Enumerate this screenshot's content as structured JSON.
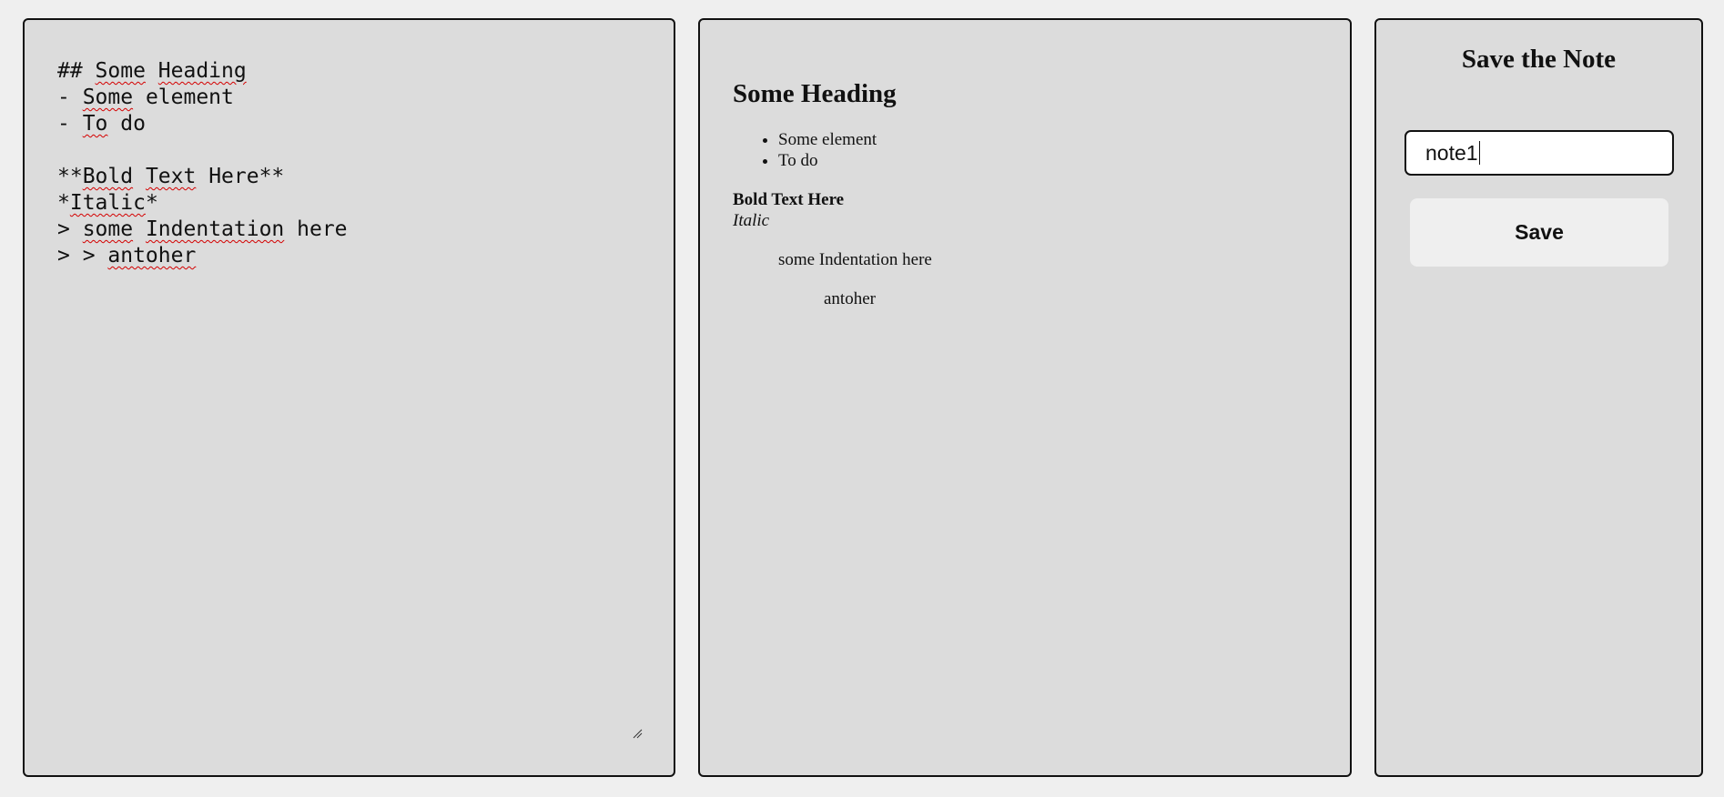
{
  "editor": {
    "lines": [
      [
        {
          "t": "## "
        },
        {
          "t": "Some",
          "sp": true
        },
        {
          "t": " "
        },
        {
          "t": "Heading",
          "sp": true
        }
      ],
      [
        {
          "t": "- "
        },
        {
          "t": "Some",
          "sp": true
        },
        {
          "t": " element"
        }
      ],
      [
        {
          "t": "- "
        },
        {
          "t": "To",
          "sp": true
        },
        {
          "t": " do"
        }
      ],
      [],
      [
        {
          "t": "**"
        },
        {
          "t": "Bold",
          "sp": true
        },
        {
          "t": " "
        },
        {
          "t": "Text",
          "sp": true
        },
        {
          "t": " Here**"
        }
      ],
      [
        {
          "t": "*"
        },
        {
          "t": "Italic",
          "sp": true
        },
        {
          "t": "*"
        }
      ],
      [
        {
          "t": "> "
        },
        {
          "t": "some",
          "sp": true
        },
        {
          "t": " "
        },
        {
          "t": "Indentation",
          "sp": true
        },
        {
          "t": " here"
        }
      ],
      [
        {
          "t": "> > "
        },
        {
          "t": "antoher",
          "sp": true
        }
      ]
    ]
  },
  "preview": {
    "heading": "Some Heading",
    "list_items": [
      "Some element",
      "To do"
    ],
    "bold_text": "Bold Text Here",
    "italic_text": "Italic",
    "quote_level1": "some Indentation here",
    "quote_level2": "antoher"
  },
  "save_panel": {
    "title": "Save the Note",
    "input_value": "note1",
    "button_label": "Save"
  },
  "colors": {
    "page_background": "#efefef",
    "panel_background": "#dcdcdc",
    "border": "#111111",
    "spellcheck_underline": "#d40000",
    "button_background": "#efefef"
  }
}
